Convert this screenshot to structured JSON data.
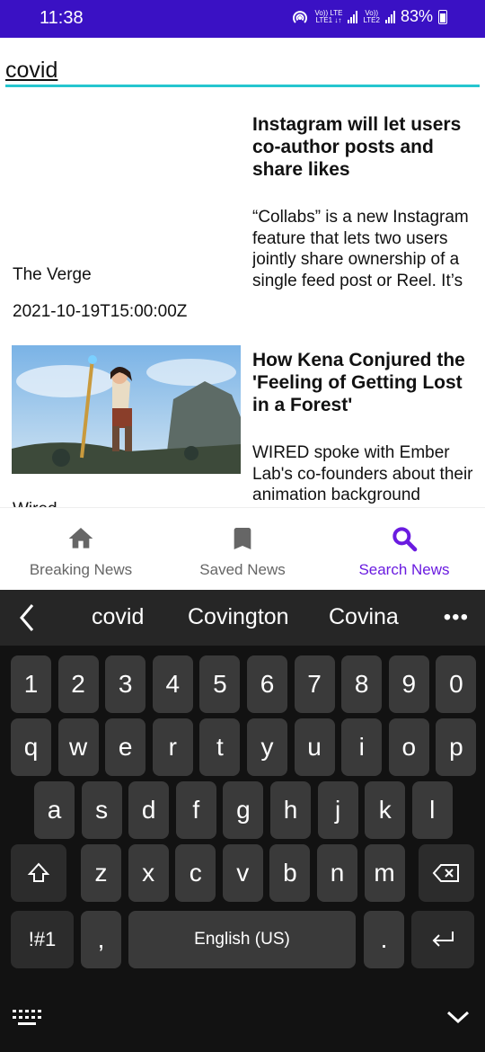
{
  "status_bar": {
    "time": "11:38",
    "lte1": "Vo)) LTE\nLTE1 ↓↑",
    "lte2": "Vo))\nLTE2",
    "battery": "83%"
  },
  "search": {
    "value": "covid"
  },
  "articles": [
    {
      "source": "The Verge",
      "date": "2021-10-19T15:00:00Z",
      "title": "Instagram will let users co-author posts and share likes",
      "description": "“Collabs” is a new Instagram feature that lets two users jointly share ownership of a single feed post or Reel. It’s also rolli…"
    },
    {
      "source": "Wired",
      "date": "",
      "title": "How Kena Conjured the 'Feeling of Getting Lost in a Forest'",
      "description": "WIRED spoke with Ember Lab's co-founders about their animation background"
    }
  ],
  "bottom_nav": [
    {
      "label": "Breaking News",
      "icon": "home-icon",
      "active": false
    },
    {
      "label": "Saved News",
      "icon": "bookmark-icon",
      "active": false
    },
    {
      "label": "Search News",
      "icon": "search-icon",
      "active": true
    }
  ],
  "keyboard": {
    "suggestions": [
      "covid",
      "Covington",
      "Covina"
    ],
    "more": "•••",
    "rows": [
      [
        "1",
        "2",
        "3",
        "4",
        "5",
        "6",
        "7",
        "8",
        "9",
        "0"
      ],
      [
        "q",
        "w",
        "e",
        "r",
        "t",
        "y",
        "u",
        "i",
        "o",
        "p"
      ],
      [
        "a",
        "s",
        "d",
        "f",
        "g",
        "h",
        "j",
        "k",
        "l"
      ],
      [
        "z",
        "x",
        "c",
        "v",
        "b",
        "n",
        "m"
      ]
    ],
    "symbols_label": "!#1",
    "comma": ",",
    "space_label": "English (US)",
    "period": "."
  },
  "colors": {
    "status_bar": "#3a11c4",
    "accent": "#6a1be0",
    "search_underline": "#26c6cf",
    "keyboard_bg": "#121212",
    "key_bg": "#3a3a3a"
  }
}
